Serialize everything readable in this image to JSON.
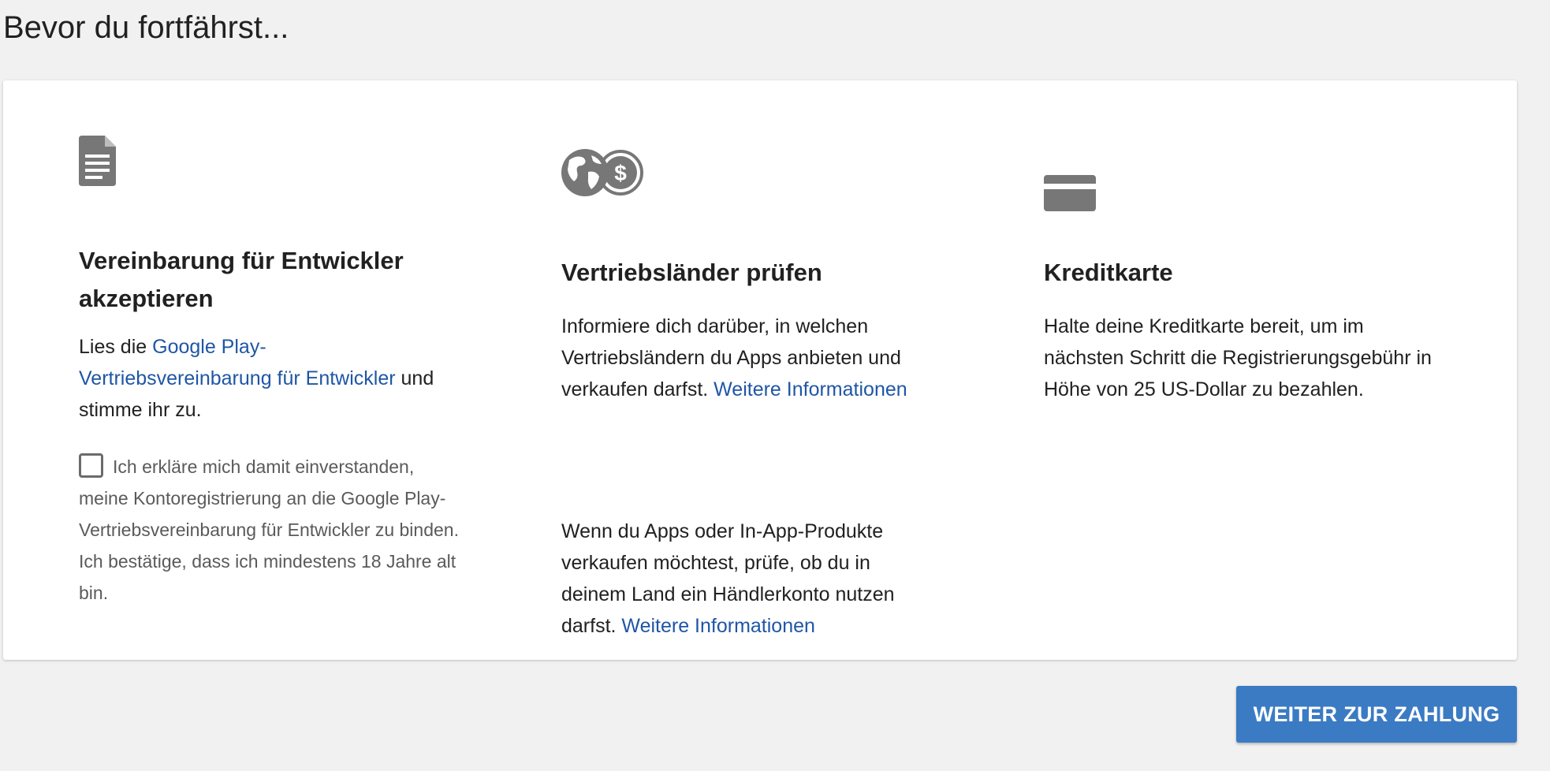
{
  "page": {
    "title": "Bevor du fortfährst..."
  },
  "agreement": {
    "icon": "document-icon",
    "heading": "Vereinbarung für Entwickler akzeptieren",
    "text_before": "Lies die ",
    "link": "Google Play-Vertriebsvereinbarung für Entwickler",
    "text_after": " und stimme ihr zu.",
    "consent_checked": false,
    "consent_label": "Ich erkläre mich damit einverstanden, meine Kontoregistrierung an die Google Play-Vertriebsvereinbarung für Entwickler zu binden. Ich bestätige, dass ich mindestens 18 Jahre alt bin."
  },
  "distribution": {
    "icon": "globe-dollar-icon",
    "heading": "Vertriebsländer prüfen",
    "p1_text": "Informiere dich darüber, in welchen Vertriebsländern du Apps anbieten und verkaufen darfst. ",
    "p1_link": "Weitere Informationen",
    "p2_text": "Wenn du Apps oder In-App-Produkte verkaufen möchtest, prüfe, ob du in deinem Land ein Händlerkonto nutzen darfst. ",
    "p2_link": "Weitere Informationen"
  },
  "credit_card": {
    "icon": "credit-card-icon",
    "heading": "Kreditkarte",
    "text": "Halte deine Kreditkarte bereit, um im nächsten Schritt die Registrierungsgebühr in Höhe von 25 US-Dollar zu bezahlen."
  },
  "actions": {
    "continue_label": "WEITER ZUR ZAHLUNG"
  },
  "colors": {
    "background": "#f1f1f1",
    "card": "#ffffff",
    "link": "#1f56a5",
    "primary_button": "#3b7bc4",
    "icon": "#777777"
  }
}
